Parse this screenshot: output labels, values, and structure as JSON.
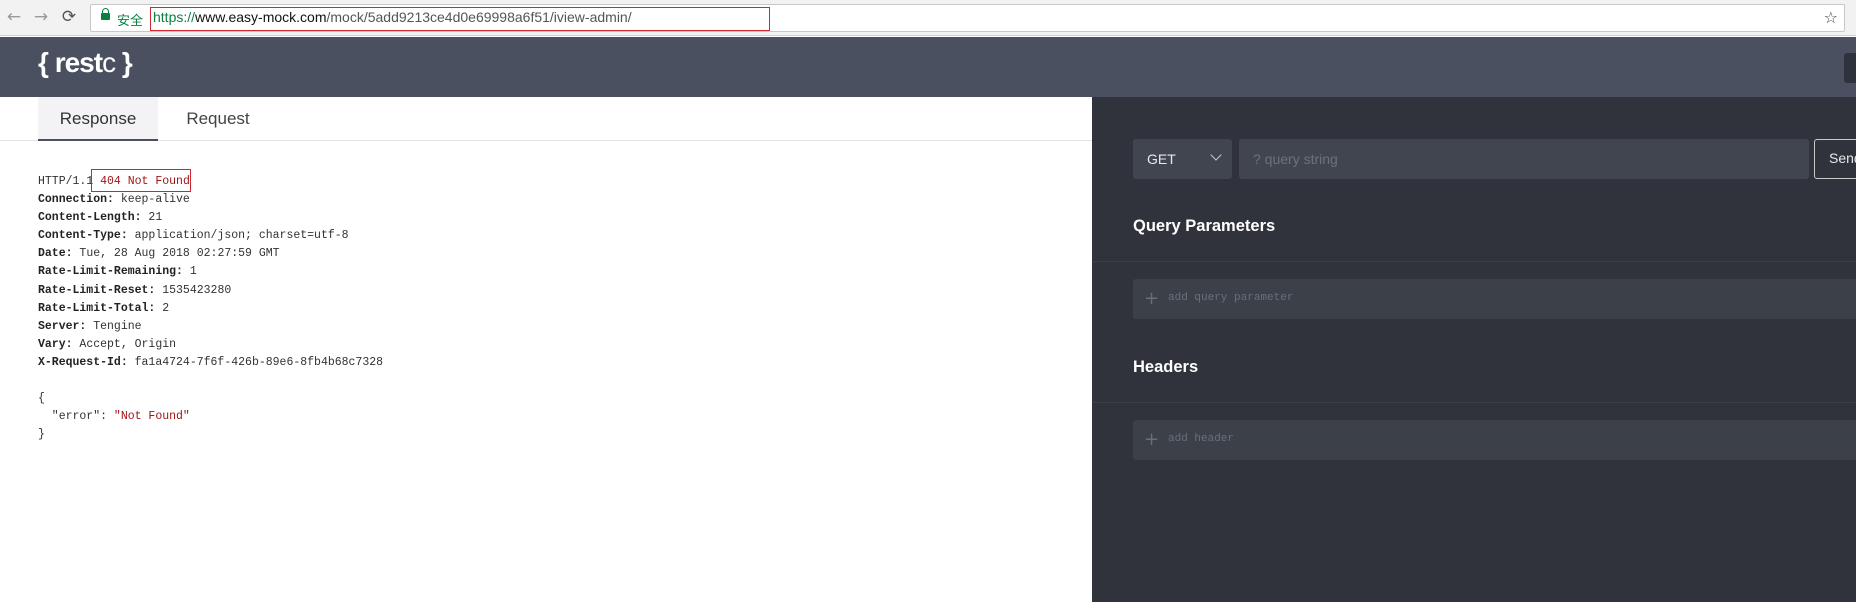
{
  "browser": {
    "back_icon": "←",
    "forward_icon": "→",
    "reload_icon": "⟳",
    "secure_label": "安全",
    "url_scheme": "https://",
    "url_host": "www.easy-mock.com",
    "url_path": "/mock/5add9213ce4d0e69998a6f51/iview-admin/",
    "star_icon": "☆"
  },
  "app": {
    "logo_open": "{ ",
    "logo_rest": "rest",
    "logo_c": "c",
    "logo_close": " }"
  },
  "tabs": [
    {
      "label": "Response",
      "active": true
    },
    {
      "label": "Request",
      "active": false
    }
  ],
  "response": {
    "status_prefix": "HTTP/1.1 ",
    "status_code": "404 Not Found",
    "headers": [
      {
        "key": "Connection:",
        "value": " keep-alive"
      },
      {
        "key": "Content-Length:",
        "value": " 21"
      },
      {
        "key": "Content-Type:",
        "value": " application/json; charset=utf-8"
      },
      {
        "key": "Date:",
        "value": " Tue, 28 Aug 2018 02:27:59 GMT"
      },
      {
        "key": "Rate-Limit-Remaining:",
        "value": " 1"
      },
      {
        "key": "Rate-Limit-Reset:",
        "value": " 1535423280"
      },
      {
        "key": "Rate-Limit-Total:",
        "value": " 2"
      },
      {
        "key": "Server:",
        "value": " Tengine"
      },
      {
        "key": "Vary:",
        "value": " Accept, Origin"
      },
      {
        "key": "X-Request-Id:",
        "value": " fa1a4724-7f6f-426b-89e6-8fb4b68c7328"
      }
    ],
    "body_open": "{",
    "body_key": "  \"error\": ",
    "body_value": "\"Not Found\"",
    "body_close": "}"
  },
  "request": {
    "method": "GET",
    "query_placeholder": "? query string",
    "send_label": "Send",
    "query_params_title": "Query Parameters",
    "add_query_param": "add query parameter",
    "headers_title": "Headers",
    "add_header": "add header",
    "plus_icon": "+"
  }
}
